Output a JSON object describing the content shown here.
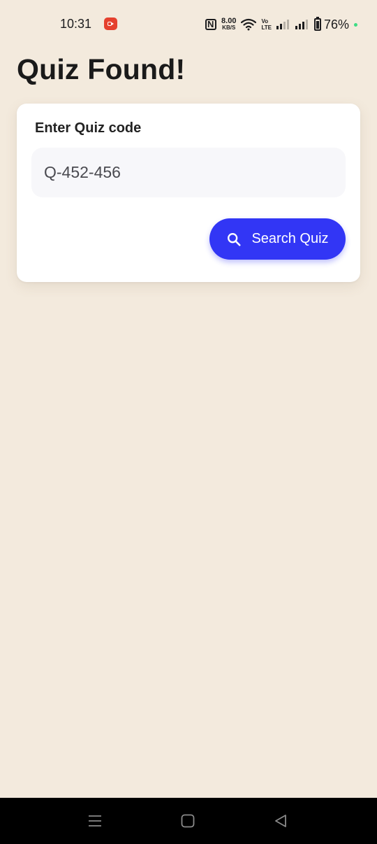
{
  "status_bar": {
    "time": "10:31",
    "net_speed_value": "8.00",
    "net_speed_unit": "KB/S",
    "volte_top": "Vo",
    "volte_bottom": "LTE",
    "battery_percent": "76%"
  },
  "page": {
    "title": "Quiz Found!"
  },
  "quiz_form": {
    "label": "Enter Quiz code",
    "input_value": "Q-452-456",
    "search_button_label": "Search Quiz"
  },
  "icons": {
    "record": "screen-record-icon",
    "nfc": "nfc-icon",
    "wifi": "wifi-icon",
    "signal": "signal-icon",
    "battery": "battery-icon",
    "search": "search-icon",
    "menu": "menu-icon",
    "home": "home-icon",
    "back": "back-icon"
  },
  "colors": {
    "background": "#F3EADD",
    "card": "#FFFFFF",
    "input_bg": "#F7F7FA",
    "accent": "#3236F5",
    "record_red": "#E5412E",
    "indicator_green": "#3DDC84"
  }
}
